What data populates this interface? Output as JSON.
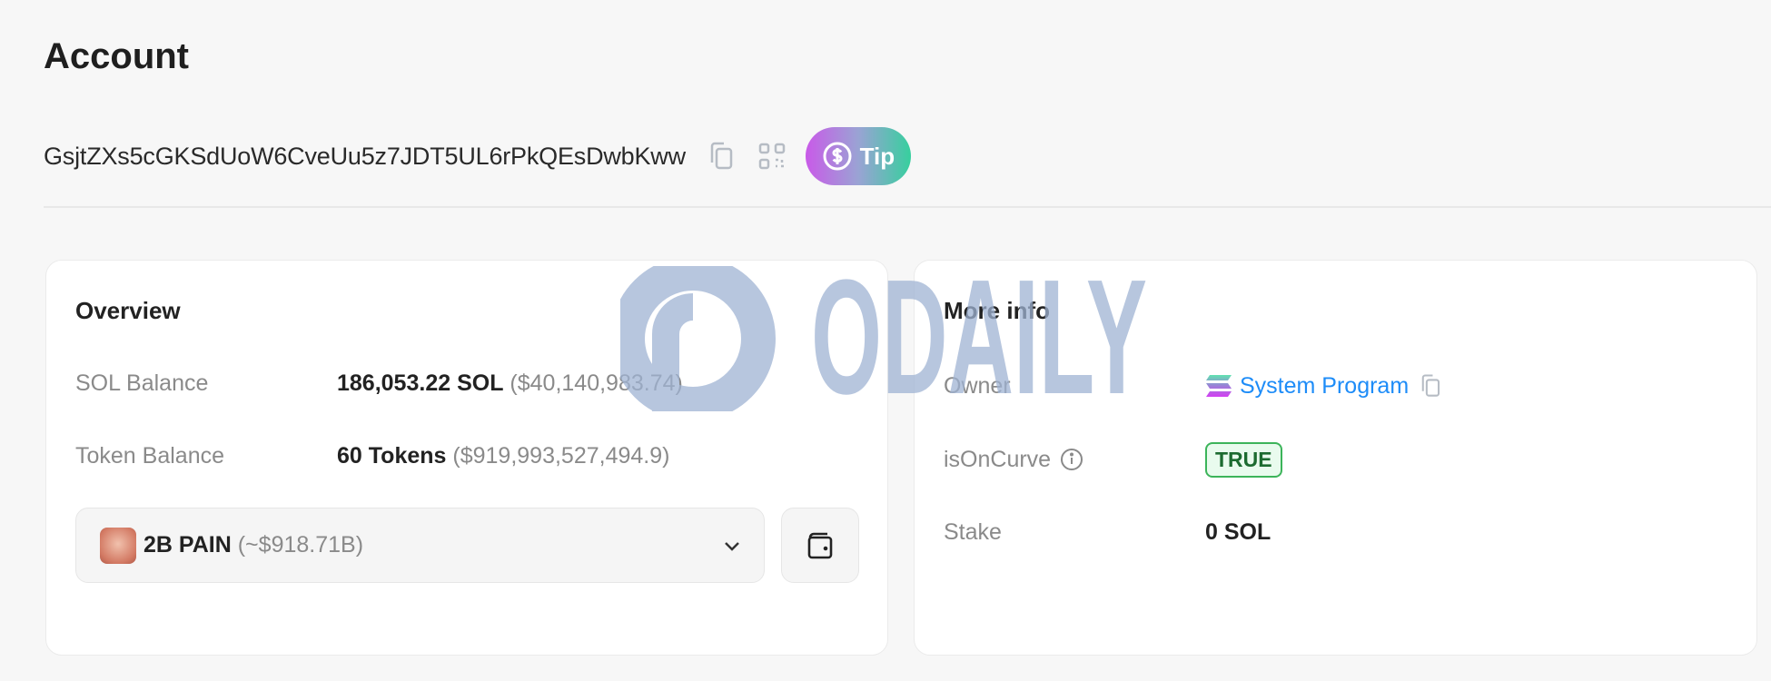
{
  "page": {
    "title": "Account"
  },
  "account": {
    "address": "GsjtZXs5cGKSdUoW6CveUu5z7JDT5UL6rPkQEsDwbKww",
    "tip_label": "Tip"
  },
  "overview": {
    "title": "Overview",
    "sol_balance": {
      "label": "SOL Balance",
      "value": "186,053.22 SOL",
      "usd": "($40,140,983.74)"
    },
    "token_balance": {
      "label": "Token Balance",
      "value": "60 Tokens",
      "usd": "($919,993,527,494.9)"
    },
    "token_select": {
      "name": "2B PAIN",
      "value": "(~$918.71B)"
    }
  },
  "more_info": {
    "title": "More info",
    "owner": {
      "label": "Owner",
      "value": "System Program"
    },
    "is_on_curve": {
      "label": "isOnCurve",
      "value": "TRUE"
    },
    "stake": {
      "label": "Stake",
      "value": "0 SOL"
    }
  },
  "watermark": {
    "text": "ODAILY",
    "color": "#9fb3d3"
  },
  "colors": {
    "link": "#1d8cf8",
    "badge_green": "#3cb45a",
    "tip_gradient": [
      "#c95ae8",
      "#37cf9e"
    ]
  }
}
